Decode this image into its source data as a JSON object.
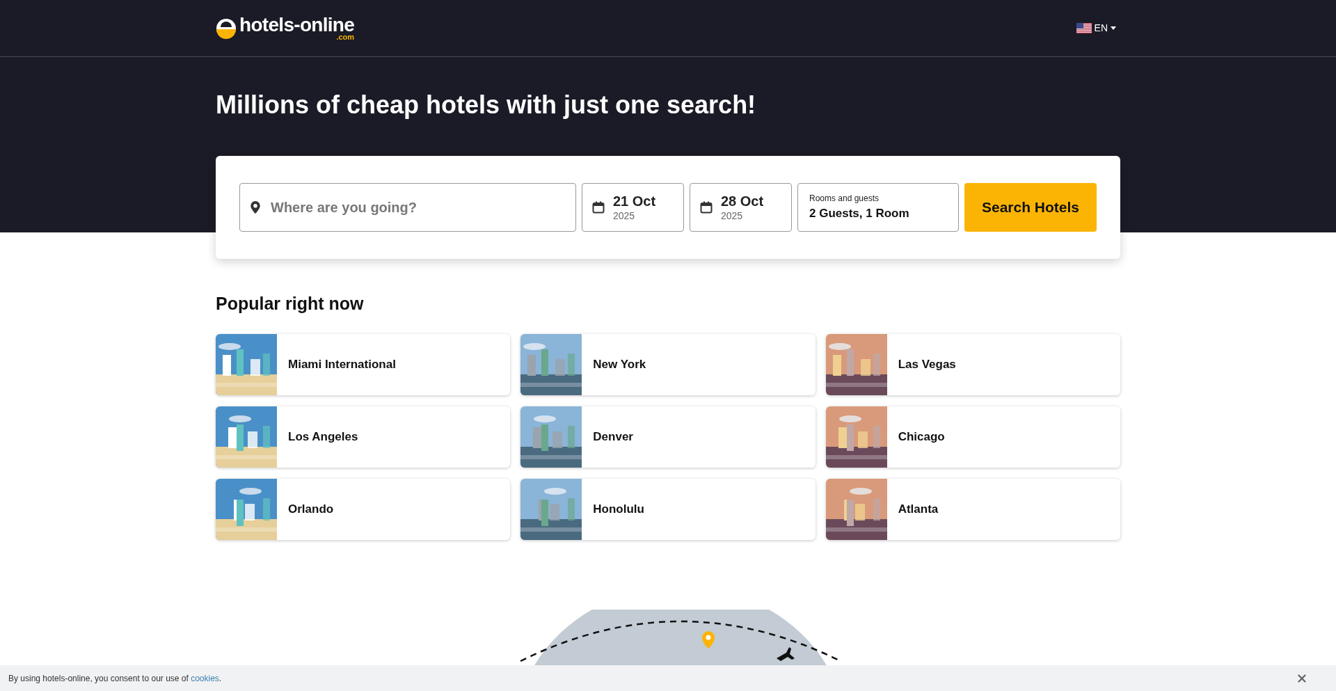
{
  "header": {
    "logo": {
      "name": "hotels-online",
      "domain": ".com"
    },
    "language": "EN"
  },
  "hero": {
    "title": "Millions of cheap hotels with just one search!"
  },
  "search": {
    "destination": {
      "placeholder": "Where are you going?"
    },
    "dates": [
      {
        "day": "21 Oct",
        "year": "2025"
      },
      {
        "day": "28 Oct",
        "year": "2025"
      }
    ],
    "guests": {
      "label": "Rooms and guests",
      "value": "2 Guests, 1 Room"
    },
    "button": "Search Hotels"
  },
  "popular": {
    "title": "Popular right now",
    "destinations": [
      {
        "name": "Miami International"
      },
      {
        "name": "New York"
      },
      {
        "name": "Las Vegas"
      },
      {
        "name": "Los Angeles"
      },
      {
        "name": "Denver"
      },
      {
        "name": "Chicago"
      },
      {
        "name": "Orlando"
      },
      {
        "name": "Honolulu"
      },
      {
        "name": "Atlanta"
      }
    ]
  },
  "cookie_bar": {
    "text": "By using hotels-online, you consent to our use of ",
    "link": "cookies",
    "suffix": "."
  }
}
